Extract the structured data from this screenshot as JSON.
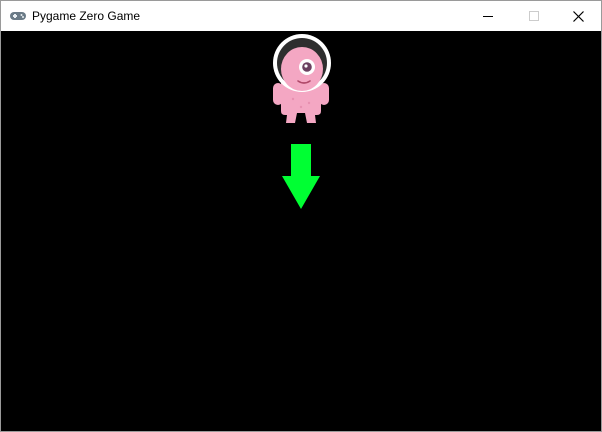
{
  "window": {
    "title": "Pygame Zero Game",
    "app_icon": "gamepad-icon",
    "controls": {
      "minimize_icon": "minimize-icon",
      "maximize_icon": "maximize-icon",
      "close_icon": "close-icon"
    }
  },
  "game": {
    "background_color": "#000000",
    "actor": {
      "icon": "alien-astronaut-icon",
      "body_color": "#f4a7c3",
      "helmet_color": "#ffffff"
    },
    "arrow": {
      "icon": "arrow-down-icon",
      "color": "#00ff33"
    }
  }
}
